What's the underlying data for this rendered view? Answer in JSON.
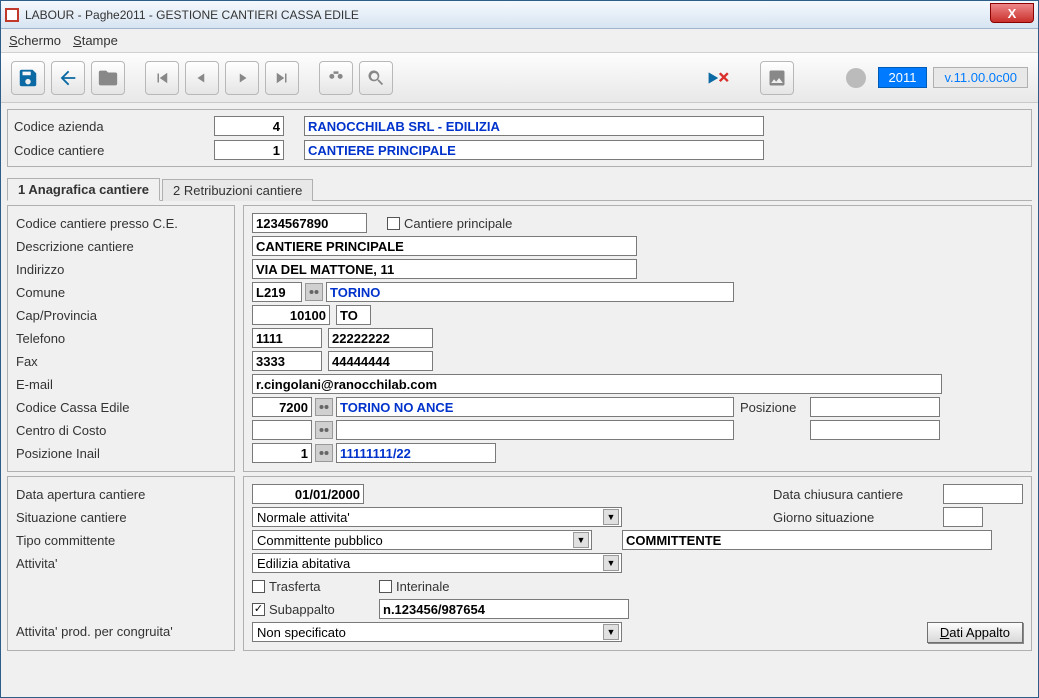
{
  "window": {
    "title": "LABOUR - Paghe2011 - GESTIONE CANTIERI CASSA EDILE"
  },
  "menu": {
    "schermo": "Schermo",
    "stampe": "Stampe"
  },
  "toolbar": {
    "year": "2011",
    "version": "v.11.00.0c00"
  },
  "header": {
    "codice_azienda_label": "Codice azienda",
    "codice_azienda_value": "4",
    "azienda_desc": "RANOCCHILAB SRL - EDILIZIA",
    "codice_cantiere_label": "Codice cantiere",
    "codice_cantiere_value": "1",
    "cantiere_desc": "CANTIERE PRINCIPALE"
  },
  "tabs": {
    "t1": "1 Anagrafica cantiere",
    "t2": "2 Retribuzioni cantiere"
  },
  "form": {
    "codice_ce_label": "Codice cantiere presso C.E.",
    "codice_ce_value": "1234567890",
    "cantiere_principale_label": "Cantiere principale",
    "descrizione_label": "Descrizione cantiere",
    "descrizione_value": "CANTIERE PRINCIPALE",
    "indirizzo_label": "Indirizzo",
    "indirizzo_value": "VIA DEL MATTONE, 11",
    "comune_label": "Comune",
    "comune_code": "L219",
    "comune_name": "TORINO",
    "cap_label": "Cap/Provincia",
    "cap_value": "10100",
    "prov_value": "TO",
    "telefono_label": "Telefono",
    "tel1": "1111",
    "tel2": "22222222",
    "fax_label": "Fax",
    "fax1": "3333",
    "fax2": "44444444",
    "email_label": "E-mail",
    "email_value": "r.cingolani@ranocchilab.com",
    "cassa_label": "Codice Cassa Edile",
    "cassa_code": "7200",
    "cassa_name": "TORINO NO ANCE",
    "posizione_label": "Posizione",
    "centro_label": "Centro di Costo",
    "inail_label": "Posizione Inail",
    "inail_code": "1",
    "inail_value": "11111111/22"
  },
  "form2": {
    "data_apertura_label": "Data apertura cantiere",
    "data_apertura_value": "01/01/2000",
    "data_chiusura_label": "Data chiusura cantiere",
    "situazione_label": "Situazione cantiere",
    "situazione_value": "Normale attivita'",
    "giorno_label": "Giorno situazione",
    "tipo_comm_label": "Tipo committente",
    "tipo_comm_value": "Committente pubblico",
    "committente_value": "COMMITTENTE",
    "attivita_label": "Attivita'",
    "attivita_value": "Edilizia abitativa",
    "trasferta_label": "Trasferta",
    "interinale_label": "Interinale",
    "subappalto_label": "Subappalto",
    "subappalto_value": "n.123456/987654",
    "congruita_label": "Attivita' prod. per congruita'",
    "congruita_value": "Non specificato",
    "dati_appalto_btn": "Dati Appalto"
  }
}
